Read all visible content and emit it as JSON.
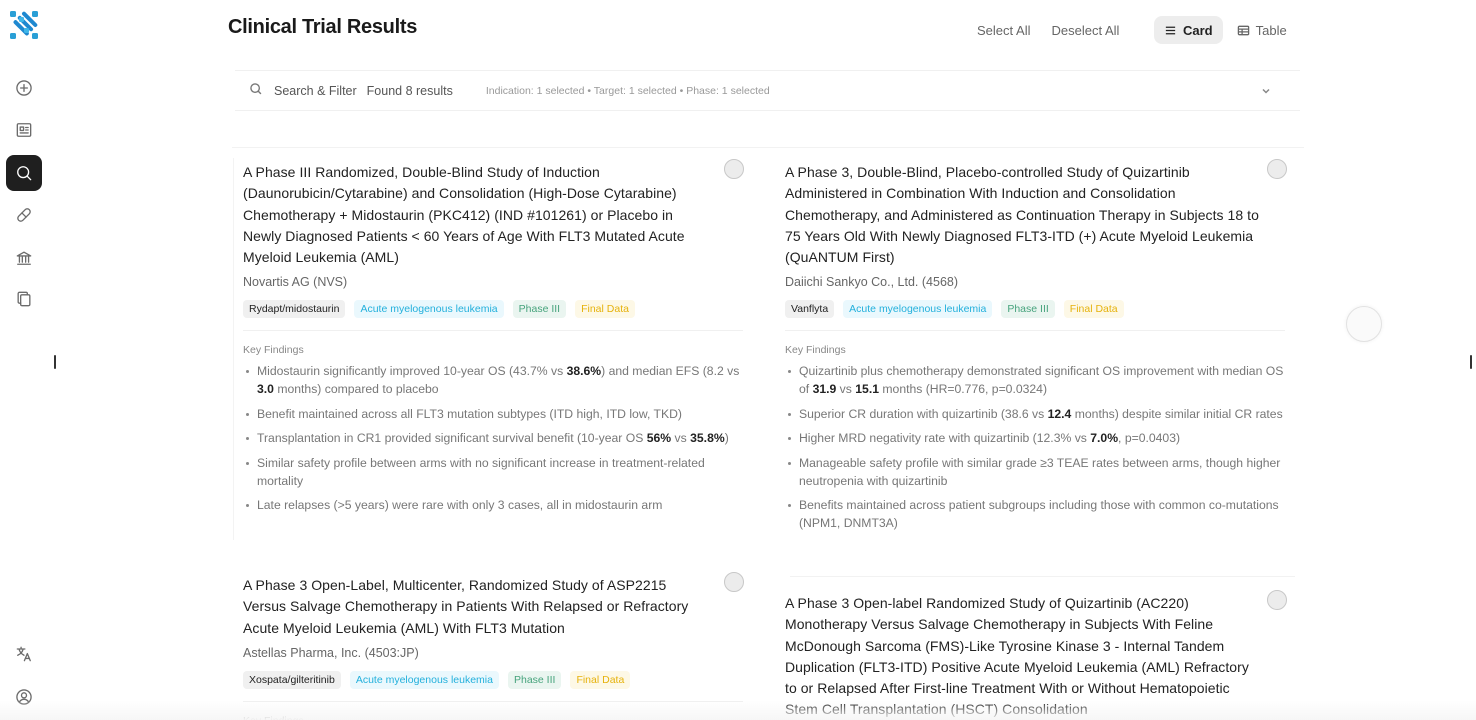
{
  "page": {
    "title": "Clinical Trial Results",
    "select_all": "Select All",
    "deselect_all": "Deselect All",
    "view_card": "Card",
    "view_table": "Table",
    "active_view": "Card"
  },
  "sidebar": {
    "active_item": "search",
    "icons": [
      "plus-circle-icon",
      "news-icon",
      "search-icon",
      "pill-icon",
      "bank-icon",
      "copy-icon",
      "translate-icon",
      "user-icon"
    ]
  },
  "filter": {
    "label": "Search & Filter",
    "results": "Found 8 results",
    "summary": "Indication: 1 selected • Target: 1 selected • Phase: 1 selected"
  },
  "key_findings_label": "Key Findings",
  "colors": {
    "indication_tag": "#23b0dc",
    "phase_tag": "#46a37c",
    "status_tag": "#e6b20c",
    "active_nav": "#1f1f1f"
  },
  "cards": [
    {
      "title": "A Phase III Randomized, Double-Blind Study of Induction (Daunorubicin/Cytarabine) and Consolidation (High-Dose Cytarabine) Chemotherapy + Midostaurin (PKC412) (IND #101261) or Placebo in Newly Diagnosed Patients < 60 Years of Age With FLT3 Mutated Acute Myeloid Leukemia (AML)",
      "company": "Novartis AG (NVS)",
      "drug": "Rydapt/midostaurin",
      "indication": "Acute myelogenous leukemia",
      "phase": "Phase III",
      "status": "Final Data",
      "findings": [
        [
          "Midostaurin significantly improved 10-year OS (43.7% vs ",
          "38.6%",
          ") and median EFS (8.2 vs ",
          "3.0",
          " months) compared to placebo"
        ],
        [
          "Benefit maintained across all FLT3 mutation subtypes (ITD high, ITD low, TKD)"
        ],
        [
          "Transplantation in CR1 provided significant survival benefit (10-year OS ",
          "56%",
          " vs ",
          "35.8%",
          ")"
        ],
        [
          "Similar safety profile between arms with no significant increase in treatment-related mortality"
        ],
        [
          "Late relapses (>5 years) were rare with only 3 cases, all in midostaurin arm"
        ]
      ]
    },
    {
      "title": "A Phase 3, Double-Blind, Placebo-controlled Study of Quizartinib Administered in Combination With Induction and Consolidation Chemotherapy, and Administered as Continuation Therapy in Subjects 18 to 75 Years Old With Newly Diagnosed FLT3-ITD (+) Acute Myeloid Leukemia (QuANTUM First)",
      "company": "Daiichi Sankyo Co., Ltd. (4568)",
      "drug": "Vanflyta",
      "indication": "Acute myelogenous leukemia",
      "phase": "Phase III",
      "status": "Final Data",
      "findings": [
        [
          "Quizartinib plus chemotherapy demonstrated significant OS improvement with median OS of ",
          "31.9",
          " vs ",
          "15.1",
          " months (HR=0.776, p=0.0324)"
        ],
        [
          "Superior CR duration with quizartinib (38.6 vs ",
          "12.4",
          " months) despite similar initial CR rates"
        ],
        [
          "Higher MRD negativity rate with quizartinib (12.3% vs ",
          "7.0%",
          ", p=0.0403)"
        ],
        [
          "Manageable safety profile with similar grade ≥3 TEAE rates between arms, though higher neutropenia with quizartinib"
        ],
        [
          "Benefits maintained across patient subgroups including those with common co-mutations (NPM1, DNMT3A)"
        ]
      ]
    },
    {
      "title": "A Phase 3 Open-Label, Multicenter, Randomized Study of ASP2215 Versus Salvage Chemotherapy in Patients With Relapsed or Refractory Acute Myeloid Leukemia (AML) With FLT3 Mutation",
      "company": "Astellas Pharma, Inc. (4503:JP)",
      "drug": "Xospata/gilteritinib",
      "indication": "Acute myelogenous leukemia",
      "phase": "Phase III",
      "status": "Final Data",
      "findings": []
    },
    {
      "title": "A Phase 3 Open-label Randomized Study of Quizartinib (AC220) Monotherapy Versus Salvage Chemotherapy in Subjects With Feline McDonough Sarcoma (FMS)-Like Tyrosine Kinase 3 - Internal Tandem Duplication (FLT3-ITD) Positive Acute Myeloid Leukemia (AML) Refractory to or Relapsed After First-line Treatment With or Without Hematopoietic Stem Cell Transplantation (HSCT) Consolidation",
      "company": "",
      "drug": "",
      "indication": "",
      "phase": "",
      "status": "",
      "findings": []
    }
  ]
}
